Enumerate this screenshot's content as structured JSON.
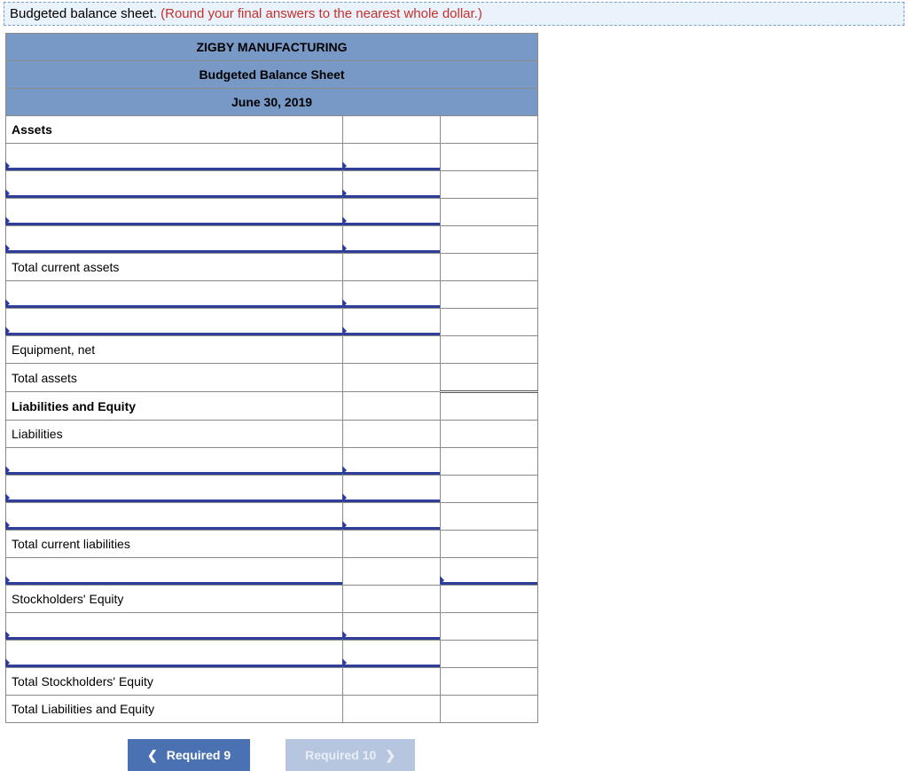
{
  "instruction": {
    "prefix": "Budgeted balance sheet. ",
    "hint": "(Round your final answers to the nearest whole dollar.)"
  },
  "header": {
    "company": "ZIGBY MANUFACTURING",
    "title": "Budgeted Balance Sheet",
    "date": "June 30, 2019"
  },
  "rows": {
    "assets": "Assets",
    "total_current_assets": "Total current assets",
    "equipment_net": "Equipment, net",
    "total_assets": "Total assets",
    "liab_equity": "Liabilities and Equity",
    "liabilities": "Liabilities",
    "total_current_liab": "Total current liabilities",
    "stockholders_equity": "Stockholders' Equity",
    "total_stockholders_equity": "Total Stockholders' Equity",
    "total_liab_equity": "Total Liabilities and Equity"
  },
  "nav": {
    "prev": "Required 9",
    "next": "Required 10"
  }
}
